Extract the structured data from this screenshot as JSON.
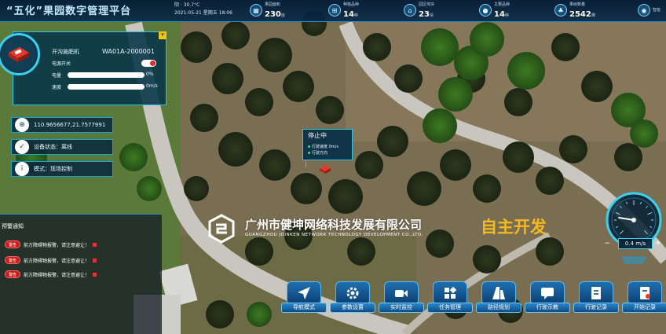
{
  "header": {
    "title": "“五化”果园数字管理平台",
    "weather": "阴 · 30.7°C",
    "datetime": "2021-05-21  星期五  18:06"
  },
  "stats": [
    {
      "icon": "area-icon",
      "label": "果园面积",
      "value": "230",
      "unit": "亩"
    },
    {
      "icon": "grid-icon",
      "label": "种植品种",
      "value": "14",
      "unit": "种"
    },
    {
      "icon": "base-icon",
      "label": "园区地块",
      "value": "23",
      "unit": "块"
    },
    {
      "icon": "fruit-icon",
      "label": "主要品种",
      "value": "14",
      "unit": "种"
    },
    {
      "icon": "tree-icon",
      "label": "果树数量",
      "value": "2542",
      "unit": "棵"
    },
    {
      "icon": "device-icon",
      "label": "智能",
      "value": "",
      "unit": ""
    }
  ],
  "machine": {
    "name": "开沟施肥机",
    "id": "WA01A-2000001",
    "power_label": "电源开关",
    "power_on": true,
    "battery_label": "电量",
    "battery_value": "0%",
    "battery_fraction": 0,
    "speed_label": "速度",
    "speed_value": "0m/s",
    "speed_fraction": 0
  },
  "info": {
    "coordinates": "110.9656677,21.7577991",
    "device_status": "设备状态：离线",
    "mode": "模式：现场控制"
  },
  "alerts": {
    "title": "预警通知",
    "items": [
      {
        "badge": "警告",
        "text": "前方障碍物报警，请注意避让！"
      },
      {
        "badge": "警告",
        "text": "前方障碍物报警，请注意避让！"
      },
      {
        "badge": "警告",
        "text": "前方障碍物报警，请注意避让！"
      }
    ]
  },
  "popup": {
    "title": "停止中",
    "line1": "行驶速度 0m/s",
    "line2": "行驶方向"
  },
  "watermark": {
    "company": "广州市健坤网络科技发展有限公司",
    "english": "GUANGZHOU JOINKEN NETWORK TECHNOLOGY DEVELOPMENT CO.,LTD.",
    "slogan": "自主开发"
  },
  "gauge": {
    "readout": "0.4 m/s",
    "speed": 0.4,
    "max": 2,
    "minus": "−",
    "plus": "+"
  },
  "toolbar": [
    {
      "label": "导航模式",
      "icon": "navigation-icon",
      "name": "nav-mode-button"
    },
    {
      "label": "参数设置",
      "icon": "gear-icon",
      "name": "settings-button"
    },
    {
      "label": "实时监控",
      "icon": "camera-icon",
      "name": "live-monitor-button"
    },
    {
      "label": "任务管理",
      "icon": "tasks-icon",
      "name": "task-manage-button"
    },
    {
      "label": "路径规划",
      "icon": "route-icon",
      "name": "route-plan-button"
    },
    {
      "label": "行驶示教",
      "icon": "teach-icon",
      "name": "drive-teach-button"
    },
    {
      "label": "行驶记录",
      "icon": "log-icon",
      "name": "drive-log-button"
    },
    {
      "label": "开始记录",
      "icon": "record-icon",
      "name": "start-record-button"
    }
  ],
  "colors": {
    "accent": "#2ec4e6",
    "alert": "#c81c1c",
    "slogan": "#f5b921",
    "progress": "#24b8ff"
  }
}
